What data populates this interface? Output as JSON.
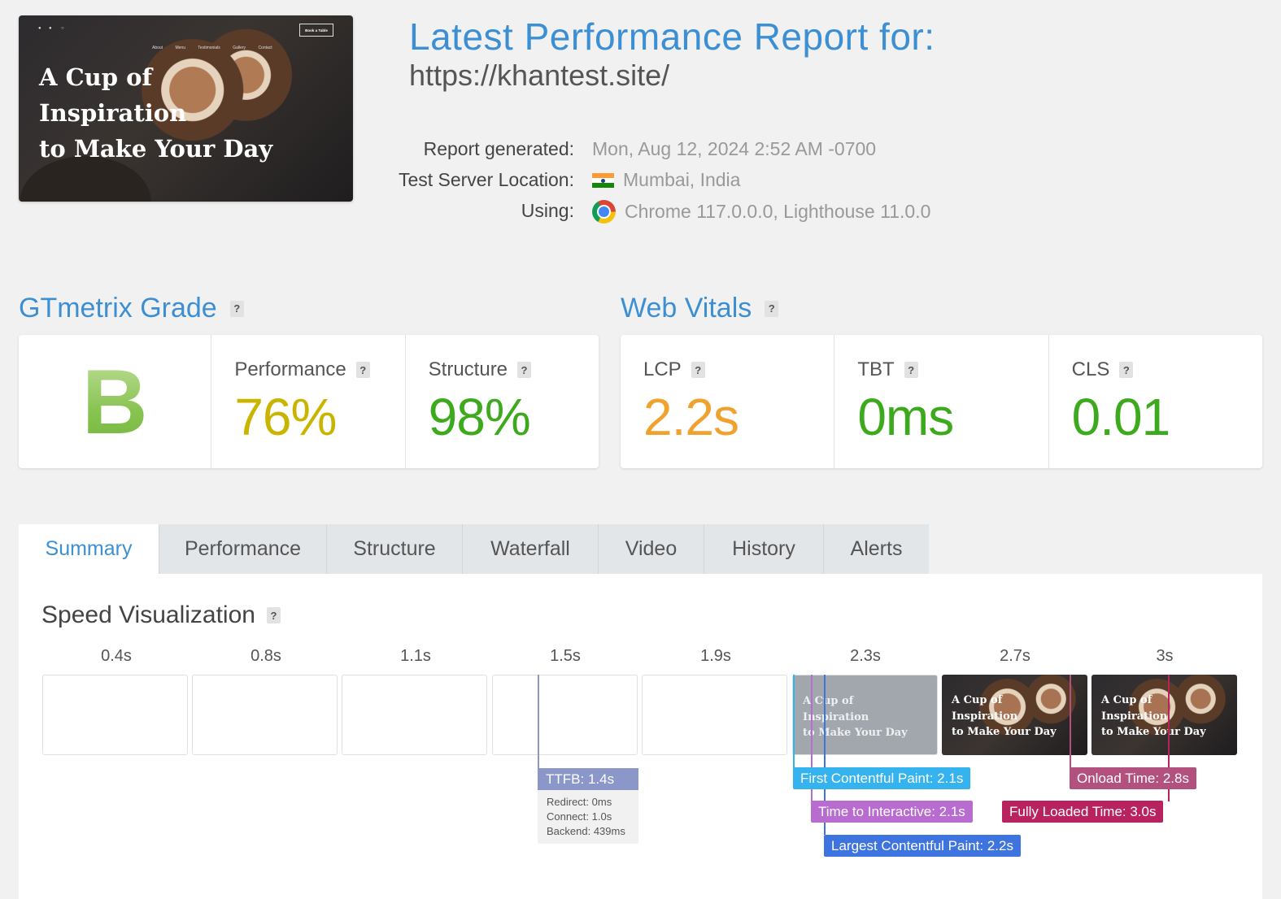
{
  "thumbnail": {
    "headline": [
      "A Cup of",
      "Inspiration",
      "to Make Your Day"
    ],
    "nav_links": [
      "About",
      "Menu",
      "Testimonials",
      "Gallery",
      "Contact"
    ],
    "book_button": "Book a Table",
    "social_icons": [
      "twitter-icon",
      "facebook-icon",
      "instagram-icon"
    ]
  },
  "header": {
    "title": "Latest Performance Report for:",
    "url": "https://khantest.site/"
  },
  "meta": {
    "generated_label": "Report generated:",
    "generated_value": "Mon, Aug 12, 2024 2:52 AM -0700",
    "location_label": "Test Server Location:",
    "location_value": "Mumbai, India",
    "location_flag": "india-flag-icon",
    "using_label": "Using:",
    "using_value": "Chrome 117.0.0.0, Lighthouse 11.0.0",
    "using_icon": "chrome-icon"
  },
  "grade": {
    "title": "GTmetrix Grade",
    "help": "?",
    "letter": "B",
    "performance_label": "Performance",
    "performance_value": "76%",
    "structure_label": "Structure",
    "structure_value": "98%"
  },
  "vitals": {
    "title": "Web Vitals",
    "help": "?",
    "lcp_label": "LCP",
    "lcp_value": "2.2s",
    "tbt_label": "TBT",
    "tbt_value": "0ms",
    "cls_label": "CLS",
    "cls_value": "0.01"
  },
  "colors": {
    "accent": "#3d8fd4",
    "performance": "#c9b400",
    "good": "#3daa1e",
    "warn": "#f0a22e",
    "ttfb": "#8a97c8",
    "fcp": "#35b3ee",
    "tti": "#b86cd0",
    "lcp": "#3e74e0",
    "onload": "#b2507e",
    "fully_loaded": "#b8235f"
  },
  "tabs": [
    "Summary",
    "Performance",
    "Structure",
    "Waterfall",
    "Video",
    "History",
    "Alerts"
  ],
  "active_tab": "Summary",
  "speed": {
    "title": "Speed Visualization",
    "help": "?",
    "ticks": [
      "0.4s",
      "0.8s",
      "1.1s",
      "1.5s",
      "1.9s",
      "2.3s",
      "2.7s",
      "3s"
    ],
    "frame_text": [
      "A Cup of",
      "Inspiration",
      "to Make Your Day"
    ],
    "ttfb_label": "TTFB: 1.4s",
    "ttfb_details": [
      "Redirect: 0ms",
      "Connect: 1.0s",
      "Backend: 439ms"
    ],
    "fcp_label": "First Contentful Paint: 2.1s",
    "tti_label": "Time to Interactive: 2.1s",
    "lcp_label": "Largest Contentful Paint: 2.2s",
    "onload_label": "Onload Time: 2.8s",
    "fully_loaded_label": "Fully Loaded Time: 3.0s"
  }
}
